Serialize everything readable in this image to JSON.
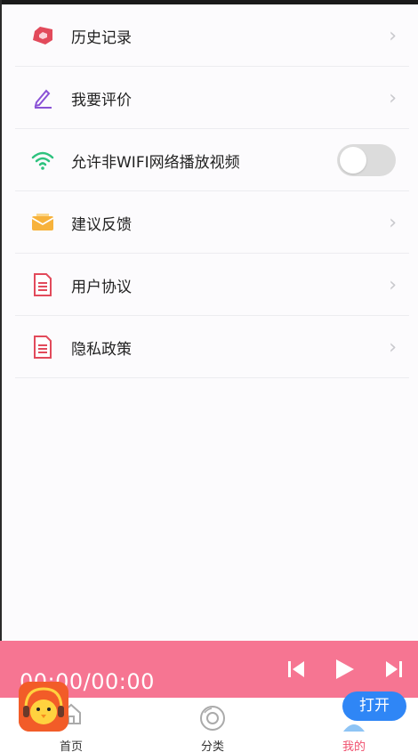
{
  "menu": {
    "items": [
      {
        "label": "历史记录",
        "icon": "history-icon",
        "type": "chevron"
      },
      {
        "label": "我要评价",
        "icon": "pencil-icon",
        "type": "chevron"
      },
      {
        "label": "允许非WIFI网络播放视频",
        "icon": "wifi-icon",
        "type": "toggle",
        "toggle_on": false
      },
      {
        "label": "建议反馈",
        "icon": "envelope-icon",
        "type": "chevron"
      },
      {
        "label": "用户协议",
        "icon": "document-icon",
        "type": "chevron"
      },
      {
        "label": "隐私政策",
        "icon": "document-icon",
        "type": "chevron"
      }
    ],
    "chevron": "›"
  },
  "player": {
    "time": "00:00/00:00",
    "color": "#f67592"
  },
  "tabs": [
    {
      "label": "首页",
      "icon": "home-icon",
      "active": false
    },
    {
      "label": "分类",
      "icon": "disc-icon",
      "active": false
    },
    {
      "label": "我的",
      "icon": "user-icon",
      "active": true
    }
  ],
  "overlay": {
    "open_label": "打开",
    "logo_icon": "chick-logo-icon"
  },
  "colors": {
    "accent": "#f0506e",
    "player_bg": "#f67592",
    "open_button": "#2f86f6"
  }
}
